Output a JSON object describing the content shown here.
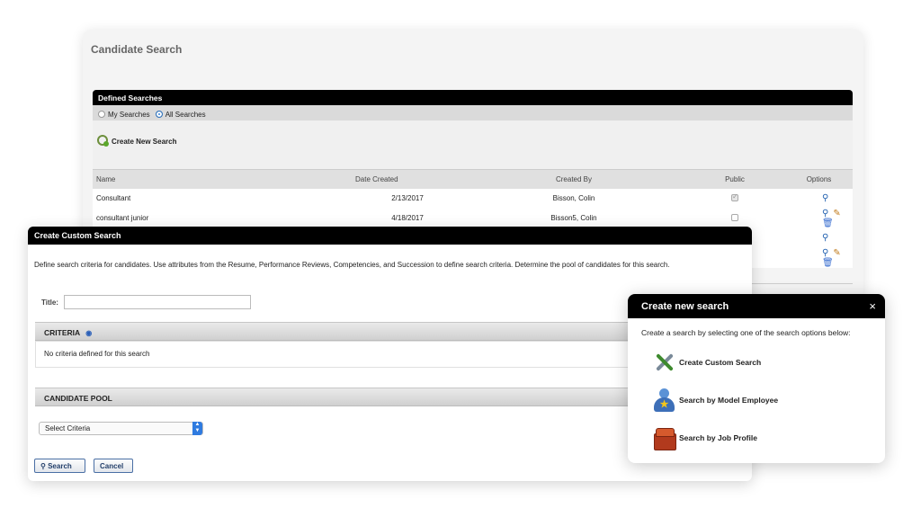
{
  "candidate_search": {
    "title": "Candidate Search",
    "defined_searches": {
      "header": "Defined Searches",
      "radio_my": "My Searches",
      "radio_all": "All Searches",
      "selected_radio": "All Searches",
      "create_link": "Create New Search",
      "columns": [
        "Name",
        "Date Created",
        "Created By",
        "Public",
        "Options"
      ],
      "rows": [
        {
          "name": "Consultant",
          "date": "2/13/2017",
          "created_by": "Bisson, Colin",
          "public": true,
          "options": [
            "view"
          ]
        },
        {
          "name": "consultant junior",
          "date": "4/18/2017",
          "created_by": "Bisson5, Colin",
          "public": false,
          "options": [
            "view",
            "edit",
            "delete"
          ]
        },
        {
          "name": "",
          "date": "",
          "created_by": "",
          "public": true,
          "options": [
            "view"
          ]
        },
        {
          "name": "",
          "date": "",
          "created_by": "",
          "public": false,
          "options": [
            "view",
            "edit",
            "delete"
          ]
        }
      ]
    }
  },
  "create_custom_search": {
    "header": "Create Custom Search",
    "description": "Define search criteria for candidates. Use attributes from the Resume, Performance Reviews, Competencies, and Succession to define search criteria. Determine the pool of candidates for this search.",
    "title_label": "Title:",
    "title_value": "",
    "criteria_label": "CRITERIA",
    "criteria_empty": "No criteria defined for this search",
    "pool_label": "CANDIDATE POOL",
    "select_value": "Select Criteria",
    "search_button": "Search",
    "cancel_button": "Cancel"
  },
  "create_new_search": {
    "header": "Create new search",
    "close": "×",
    "description": "Create a search by selecting one of the search options below:",
    "options": [
      {
        "label": "Create Custom Search",
        "icon": "tools-icon"
      },
      {
        "label": "Search by Model Employee",
        "icon": "model-employee-icon"
      },
      {
        "label": "Search by Job Profile",
        "icon": "job-profile-icon"
      }
    ]
  }
}
